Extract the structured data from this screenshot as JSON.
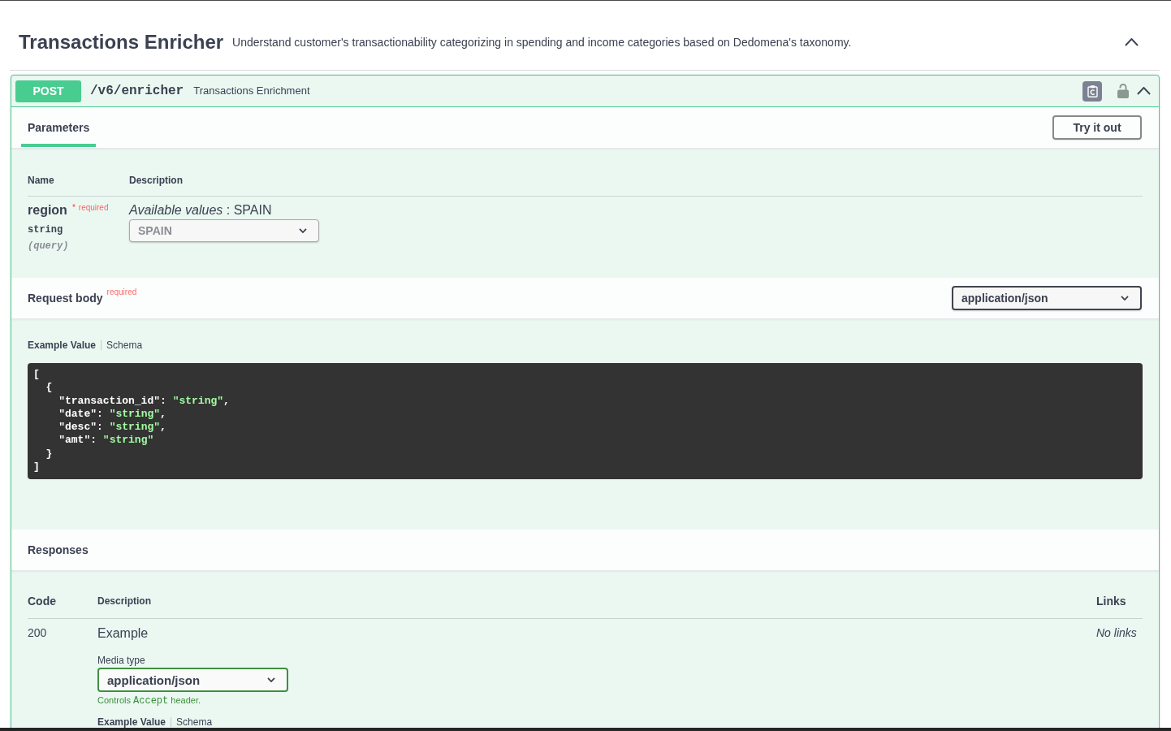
{
  "section": {
    "title": "Transactions Enricher",
    "description": "Understand customer's transactionability categorizing in spending and income categories based on Dedomena's taxonomy.",
    "expanded": true
  },
  "operation": {
    "method": "POST",
    "path": "/v6/enricher",
    "summary": "Transactions Enrichment",
    "locked": false,
    "expanded": true,
    "parameters": {
      "tabs": [
        {
          "label": "Parameters",
          "selected": true
        }
      ],
      "try_button": "Try it out",
      "columns": [
        "Name",
        "Description"
      ],
      "rows": [
        {
          "name": "region",
          "required_mark": "*",
          "required_label": "required",
          "type": "string",
          "location": "(query)",
          "available_values": "*Available values* : SPAIN",
          "select": {
            "value": "SPAIN",
            "disabled": true
          }
        }
      ]
    },
    "request_body": {
      "title": "Request body",
      "required_label": "required",
      "content_type": "application/json",
      "example_tabs": [
        {
          "label": "Example Value",
          "selected": true
        },
        {
          "label": "Schema",
          "selected": false
        }
      ],
      "example_code": [
        {
          "tokens": [
            {
              "kind": "punct",
              "text": "["
            }
          ]
        },
        {
          "tokens": [
            {
              "kind": "punct",
              "text": "  {"
            }
          ]
        },
        {
          "tokens": [
            {
              "kind": "key",
              "text": "    \"transaction_id\""
            },
            {
              "kind": "punct",
              "text": ": "
            },
            {
              "kind": "string",
              "text": "\"string\""
            },
            {
              "kind": "punct",
              "text": ","
            }
          ]
        },
        {
          "tokens": [
            {
              "kind": "key",
              "text": "    \"date\""
            },
            {
              "kind": "punct",
              "text": ": "
            },
            {
              "kind": "string",
              "text": "\"string\""
            },
            {
              "kind": "punct",
              "text": ","
            }
          ]
        },
        {
          "tokens": [
            {
              "kind": "key",
              "text": "    \"desc\""
            },
            {
              "kind": "punct",
              "text": ": "
            },
            {
              "kind": "string",
              "text": "\"string\""
            },
            {
              "kind": "punct",
              "text": ","
            }
          ]
        },
        {
          "tokens": [
            {
              "kind": "key",
              "text": "    \"amt\""
            },
            {
              "kind": "punct",
              "text": ": "
            },
            {
              "kind": "string",
              "text": "\"string\""
            }
          ]
        },
        {
          "tokens": [
            {
              "kind": "punct",
              "text": "  }"
            }
          ]
        },
        {
          "tokens": [
            {
              "kind": "punct",
              "text": "]"
            }
          ]
        }
      ]
    },
    "responses": {
      "title": "Responses",
      "columns": [
        "Code",
        "Description",
        "Links"
      ],
      "rows": [
        {
          "code": "200",
          "description": "Example",
          "media_type_label": "Media type",
          "media_type": "application/json",
          "media_note": [
            {
              "kind": "text",
              "text": "Controls"
            },
            {
              "kind": "code",
              "text": "Accept"
            },
            {
              "kind": "text",
              "text": "header."
            }
          ],
          "example_tabs": [
            {
              "label": "Example Value",
              "selected": true
            },
            {
              "label": "Schema",
              "selected": false
            }
          ],
          "links": "No links"
        }
      ]
    }
  }
}
